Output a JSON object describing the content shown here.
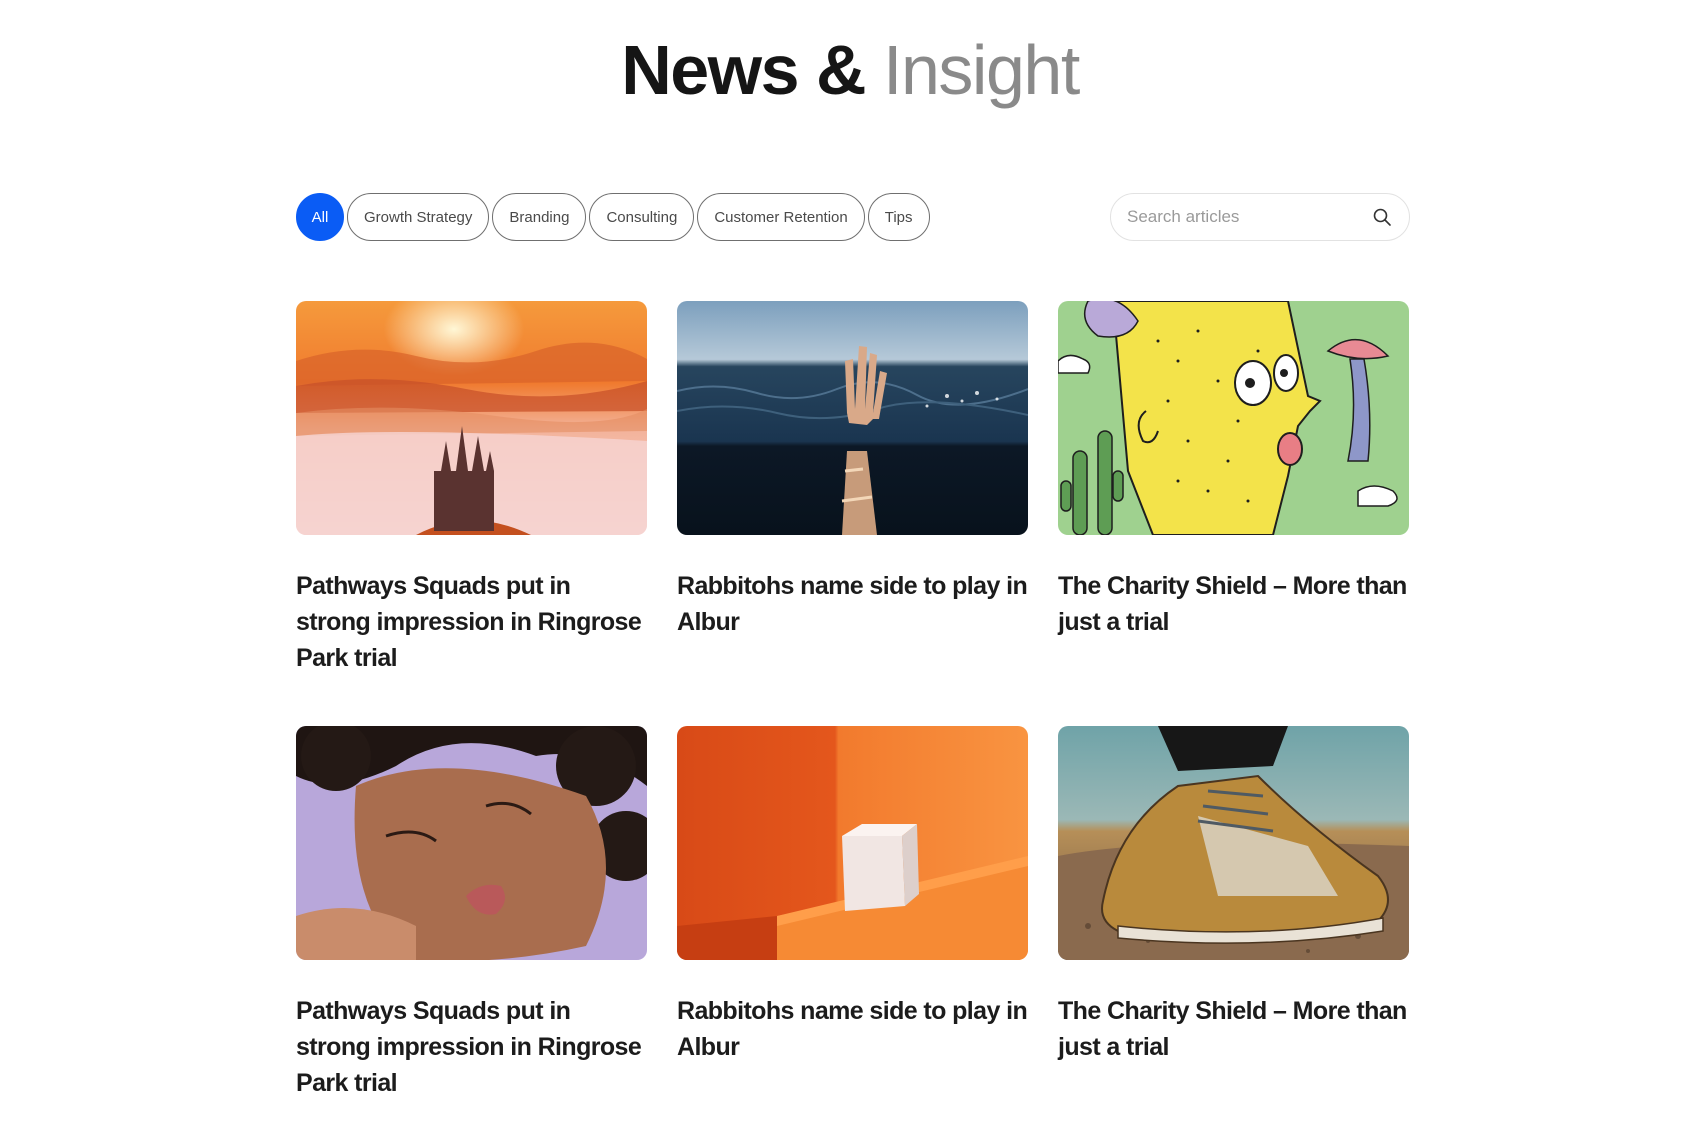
{
  "header": {
    "title_dark": "News &",
    "title_light": "Insight"
  },
  "filters": [
    {
      "label": "All",
      "active": true
    },
    {
      "label": "Growth Strategy",
      "active": false
    },
    {
      "label": "Branding",
      "active": false
    },
    {
      "label": "Consulting",
      "active": false
    },
    {
      "label": "Customer Retention",
      "active": false
    },
    {
      "label": "Tips",
      "active": false
    }
  ],
  "search": {
    "placeholder": "Search articles",
    "icon": "search-icon"
  },
  "articles": [
    {
      "title": "Pathways Squads put in strong impression in Ringrose Park trial",
      "image": "sunset-castle-image"
    },
    {
      "title": "Rabbitohs name side to play in Albur",
      "image": "hand-in-ocean-image"
    },
    {
      "title": "The Charity Shield – More than just a trial",
      "image": "cartoon-face-image"
    },
    {
      "title": "Pathways Squads put in strong impression in Ringrose Park trial",
      "image": "woman-portrait-image"
    },
    {
      "title": "Rabbitohs name side to play in Albur",
      "image": "white-cube-image"
    },
    {
      "title": "The Charity Shield – More than just a trial",
      "image": "sneaker-image"
    }
  ],
  "colors": {
    "accent": "#0a5cf5",
    "title_light": "#8a8a8a"
  }
}
